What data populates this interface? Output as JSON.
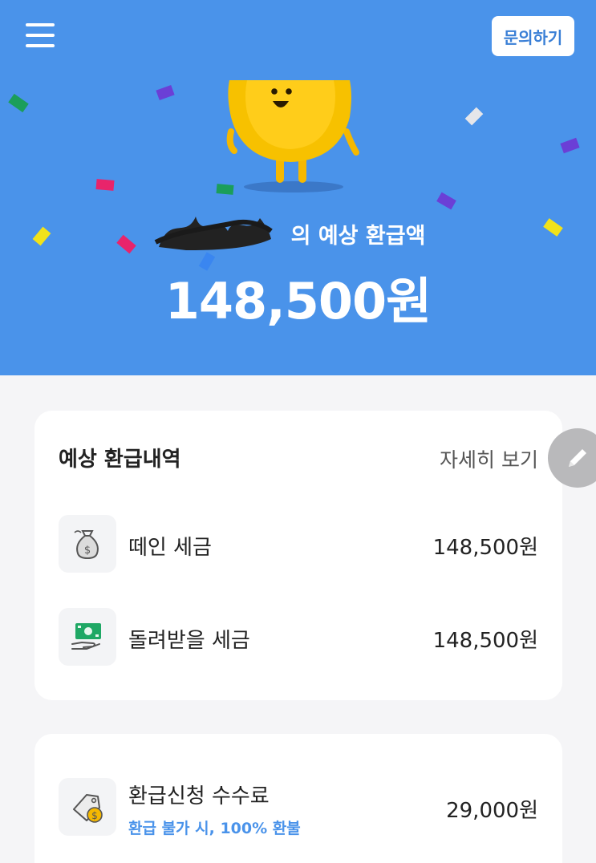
{
  "header": {
    "inquiry_label": "문의하기"
  },
  "hero": {
    "label": "의 예상 환급액",
    "amount": "148,500원"
  },
  "refund_card": {
    "title": "예상 환급내역",
    "detail_link": "자세히 보기",
    "items": [
      {
        "label": "떼인 세금",
        "value": "148,500원",
        "icon": "money-bag-icon"
      },
      {
        "label": "돌려받을 세금",
        "value": "148,500원",
        "icon": "cash-hand-icon"
      }
    ]
  },
  "fee_card": {
    "label": "환급신청 수수료",
    "sub_label": "환급 불가 시, 100% 환불",
    "value": "29,000원",
    "icon": "coin-tag-icon"
  },
  "colors": {
    "hero_bg": "#4a93ea",
    "accent": "#4a93ea",
    "card_bg": "#ffffff",
    "page_bg": "#f5f5f7"
  }
}
